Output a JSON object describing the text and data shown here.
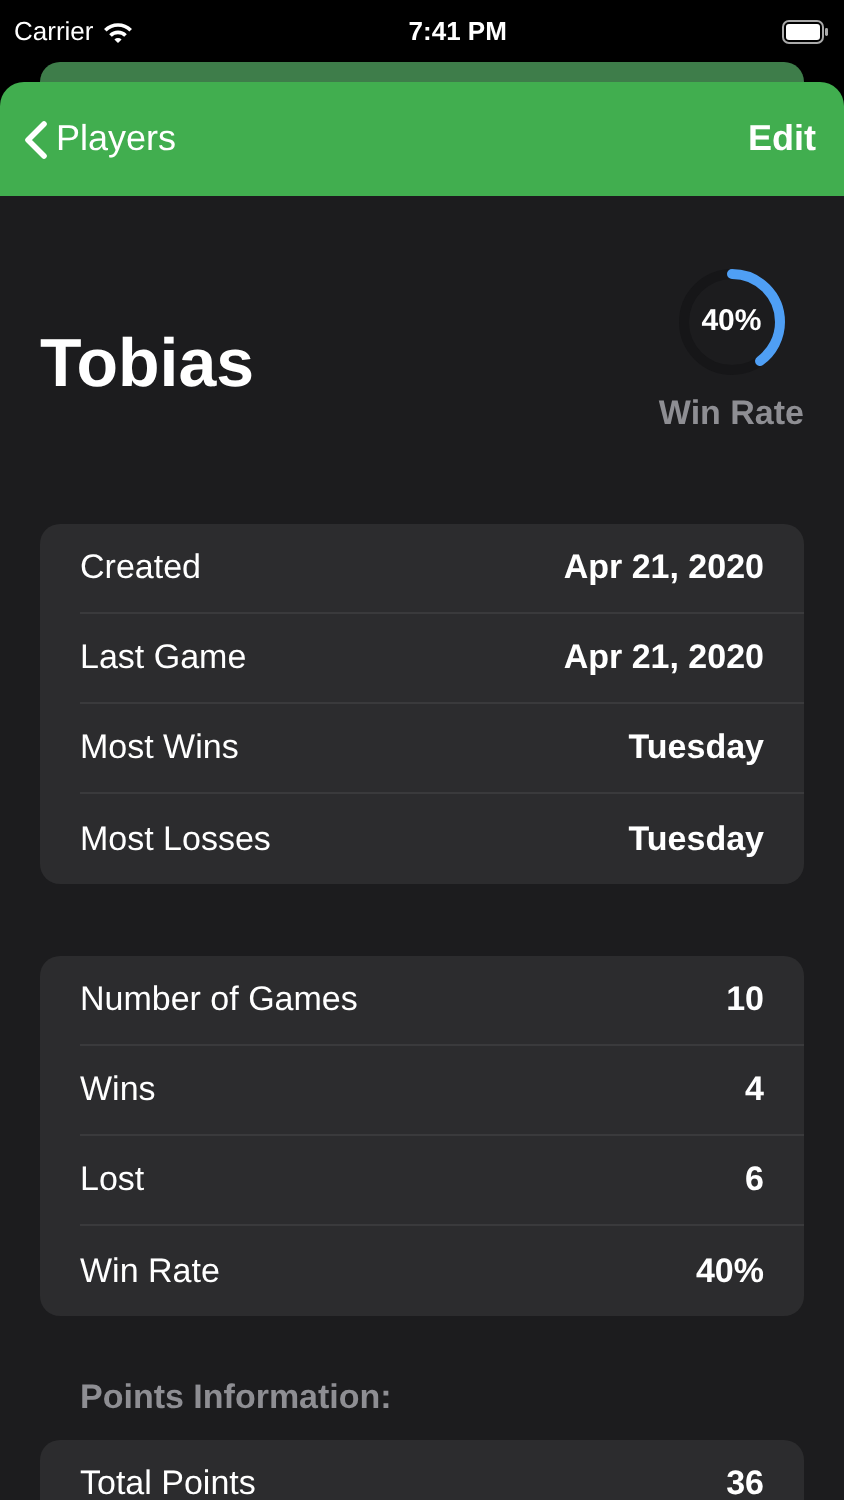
{
  "status_bar": {
    "carrier": "Carrier",
    "time": "7:41 PM"
  },
  "nav": {
    "back": "Players",
    "action": "Edit"
  },
  "player": {
    "name": "Tobias",
    "win_rate": {
      "level": 0.4,
      "reading": "40%",
      "label": "Win Rate"
    }
  },
  "groups": [
    {
      "rows": [
        {
          "label": "Created",
          "value": "Apr 21, 2020"
        },
        {
          "label": "Last Game",
          "value": "Apr 21, 2020"
        },
        {
          "label": "Most Wins",
          "value": "Tuesday"
        },
        {
          "label": "Most Losses",
          "value": "Tuesday"
        }
      ]
    },
    {
      "rows": [
        {
          "label": "Number of Games",
          "value": "10"
        },
        {
          "label": "Wins",
          "value": "4"
        },
        {
          "label": "Lost",
          "value": "6"
        },
        {
          "label": "Win Rate",
          "value": "40%"
        }
      ]
    },
    {
      "header": "Points Information:",
      "rows": [
        {
          "label": "Total Points",
          "value": "36"
        }
      ]
    }
  ]
}
